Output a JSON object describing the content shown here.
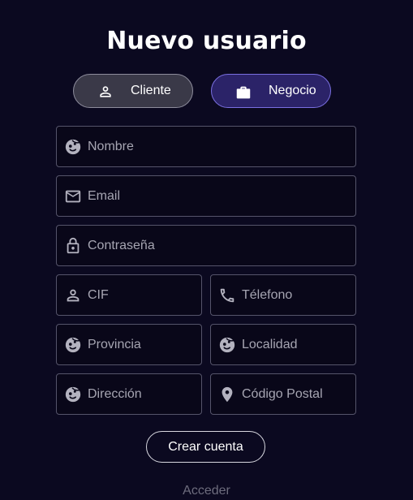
{
  "title": "Nuevo usuario",
  "account_type": {
    "client_label": "Cliente",
    "business_label": "Negocio",
    "selected": "Negocio"
  },
  "fields": {
    "nombre": {
      "placeholder": "Nombre",
      "icon": "face-icon"
    },
    "email": {
      "placeholder": "Email",
      "icon": "mail-icon"
    },
    "password": {
      "placeholder": "Contraseña",
      "icon": "lock-icon"
    },
    "cif": {
      "placeholder": "CIF",
      "icon": "person-icon"
    },
    "telefono": {
      "placeholder": "Télefono",
      "icon": "phone-icon"
    },
    "provincia": {
      "placeholder": "Provincia",
      "icon": "face-icon"
    },
    "localidad": {
      "placeholder": "Localidad",
      "icon": "face-icon"
    },
    "direccion": {
      "placeholder": "Dirección",
      "icon": "face-icon"
    },
    "codigo_postal": {
      "placeholder": "Código Postal",
      "icon": "location-pin-icon"
    }
  },
  "submit_label": "Crear cuenta",
  "login_link": "Acceder",
  "colors": {
    "background": "#0b0920",
    "business_active": "#2b2368",
    "business_border": "#7a6fe0",
    "client_inactive": "#3a3948",
    "field_border": "#55546a",
    "icon": "#b3b2bf",
    "link_muted": "#6d6c7d"
  }
}
